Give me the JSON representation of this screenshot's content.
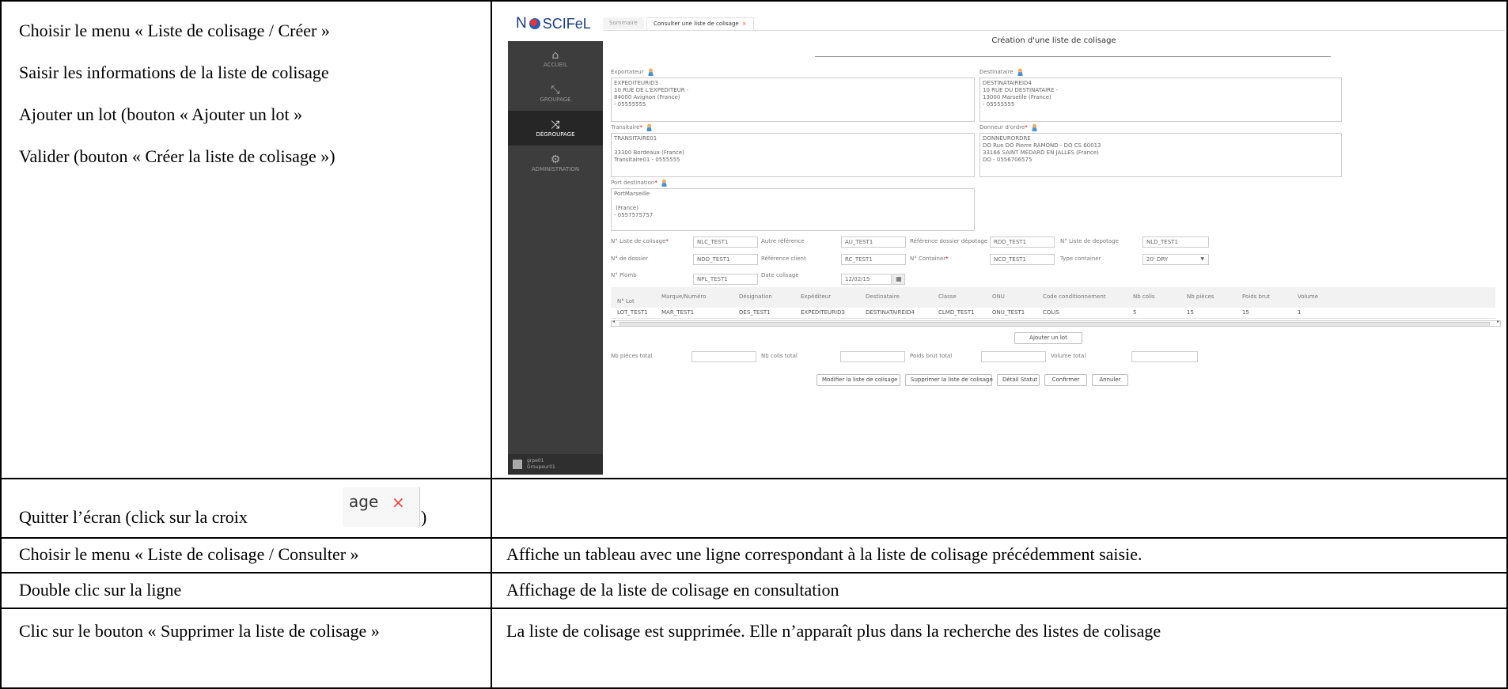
{
  "steps_top": [
    "Choisir le menu « Liste de colisage / Créer »",
    "Saisir les informations de la liste de colisage",
    "Ajouter un lot (bouton « Ajouter un lot »",
    "Valider (bouton « Créer la liste de colisage »)"
  ],
  "quit": {
    "text": "Quitter l’écran (click sur la croix",
    "close_paren": ")",
    "snippet_text": "age",
    "snippet_close": "×"
  },
  "rows": [
    {
      "step": "Choisir le menu « Liste de colisage / Consulter »",
      "result": "Affiche un tableau avec une ligne correspondant à la liste de colisage précédemment saisie."
    },
    {
      "step": "Double clic sur la ligne",
      "result": "Affichage de la liste de colisage en consultation"
    },
    {
      "step": "Clic sur le bouton « Supprimer la liste de colisage »",
      "result": "La liste de colisage est supprimée. Elle n’apparaît plus dans la recherche des listes de colisage"
    }
  ],
  "app": {
    "logo_n": "N",
    "logo_brand": "SCIFeL",
    "menu": [
      {
        "label": "ACCUEIL",
        "icon": "home-icon",
        "glyph": "⌂"
      },
      {
        "label": "GROUPAGE",
        "icon": "compress-icon",
        "glyph": "⤡"
      },
      {
        "label": "DÉGROUPAGE",
        "icon": "shuffle-icon",
        "glyph": "⤨"
      },
      {
        "label": "ADMINISTRATION",
        "icon": "cogs-icon",
        "glyph": "⚙"
      }
    ],
    "user_name": "grpe01",
    "user_role": "Groupeur01",
    "tabs": [
      "Sommaire",
      "Consulter une liste de colisage"
    ],
    "tab_close": "×",
    "page_title": "Création d'une liste de colisage",
    "parties": {
      "exportateur": {
        "label": "Exportateur",
        "text": "EXPEDITEURID3\n10 RUE DE L'EXPEDITEUR -\n84000 Avignon (France)\n- 05555555"
      },
      "destinataire": {
        "label": "Destinataire",
        "text": "DESTINATAIREID4\n10 RUE DU DESTINATAIRE -\n13000 Marseille (France)\n- 05555555"
      },
      "transitaire": {
        "label": "Transitaire",
        "text": "TRANSITAIRE01\n\n33300 Bordeaux (France)\nTransitaire01 - 0555555"
      },
      "donneur": {
        "label": "Donneur d'ordre",
        "text": "DONNEURORDRE\nDO Rue DO Pierre RAMOND - DO CS 60013\n33166 SAINT MEDARD EN JALLES (France)\nDO - 0556706575"
      },
      "port": {
        "label": "Port destination",
        "text": "PortMarseille\n\n (France)\n- 0557575757"
      }
    },
    "required_mark": "*",
    "fields": {
      "nlc": {
        "label": "N° Liste de colisage",
        "value": "NLC_TEST1"
      },
      "autre": {
        "label": "Autre référence",
        "value": "AU_TEST1"
      },
      "rdd": {
        "label": "Référence dossier dépotage",
        "value": "RDD_TEST1"
      },
      "nld": {
        "label": "N° Liste de depotage",
        "value": "NLD_TEST1"
      },
      "ndo": {
        "label": "N° de dossier",
        "value": "NDO_TEST1"
      },
      "rc": {
        "label": "Référence client",
        "value": "RC_TEST1"
      },
      "nco": {
        "label": "N° Container",
        "value": "NCO_TEST1"
      },
      "type": {
        "label": "Type container",
        "value": "20' DRY",
        "arrow": "▼"
      },
      "npl": {
        "label": "N° Plomb",
        "value": "NPL_TEST1"
      },
      "date": {
        "label": "Date colisage",
        "value": "12/02/15",
        "cal": "▦"
      }
    },
    "table": {
      "headers": [
        "N° Lot",
        "Marque/Numéro",
        "Désignation",
        "Expéditeur",
        "Destinataire",
        "Classe",
        "ONU",
        "Code conditionnement",
        "Nb colis",
        "Nb pièces",
        "Poids brut",
        "Volume"
      ],
      "row": [
        "LOT_TEST1",
        "MAR_TEST1",
        "DES_TEST1",
        "EXPEDITEURID3",
        "DESTINATAIREID4",
        "CLMD_TEST1",
        "ONU_TEST1",
        "COLIS",
        "5",
        "15",
        "15",
        "1"
      ]
    },
    "scroll_left": "◂",
    "scroll_right": "▸",
    "add_lot": "Ajouter un lot",
    "totals": {
      "pieces": "Nb pièces total",
      "colis": "Nb colis total",
      "poids": "Poids brut total",
      "volume": "Volume total"
    },
    "buttons": [
      "Modifier la liste de colisage",
      "Supprimer la liste de colisage",
      "Détail Statut",
      "Confirmer",
      "Annuler"
    ]
  }
}
